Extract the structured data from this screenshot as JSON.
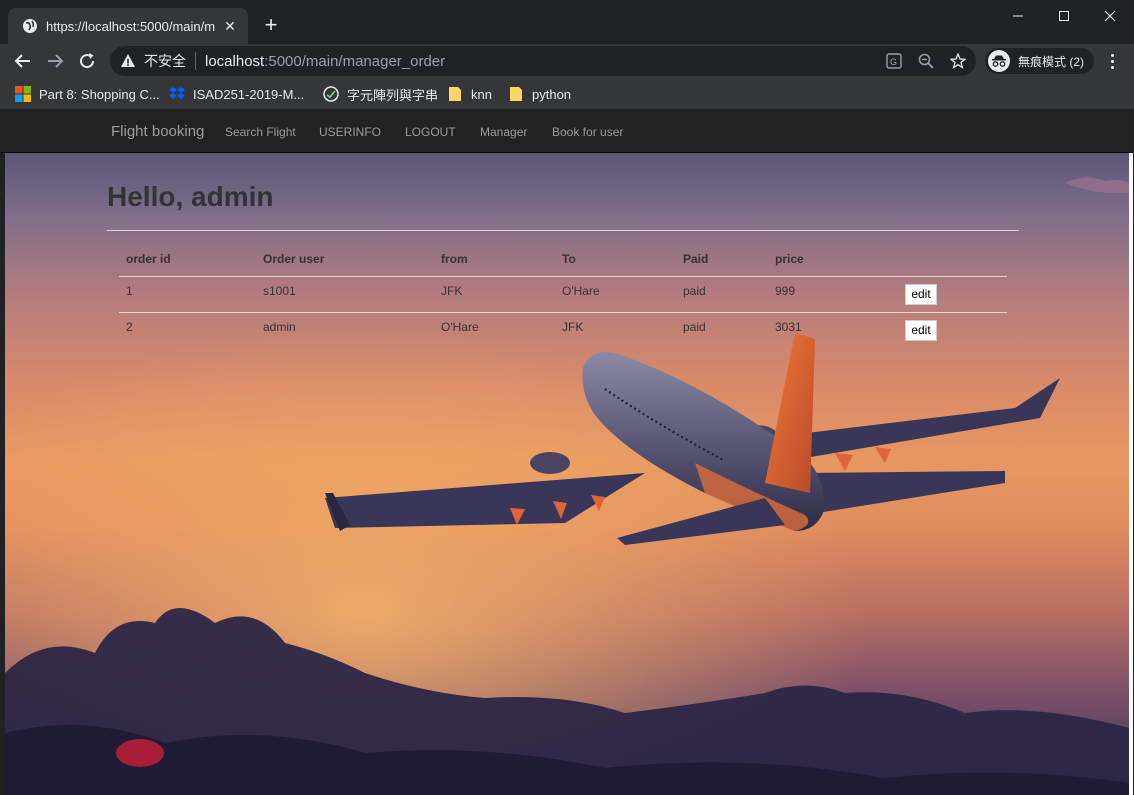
{
  "browser": {
    "tab_title": "https://localhost:5000/main/m",
    "address": {
      "security_label": "不安全",
      "host": "localhost",
      "path": ":5000/main/manager_order"
    },
    "incognito_label": "無痕模式 (2)",
    "bookmarks": [
      {
        "label": "Part 8: Shopping C...",
        "icon": "microsoft-icon"
      },
      {
        "label": "ISAD251-2019-M...",
        "icon": "dropbox-icon"
      },
      {
        "label": "字元陣列與字串",
        "icon": "site-icon"
      },
      {
        "label": "knn",
        "icon": "folder-icon"
      },
      {
        "label": "python",
        "icon": "folder-icon"
      }
    ]
  },
  "site": {
    "brand": "Flight booking",
    "nav": [
      "Search Flight",
      "USERINFO",
      "LOGOUT",
      "Manager",
      "Book for user"
    ]
  },
  "main": {
    "greeting": "Hello, admin",
    "table": {
      "headers": [
        "order id",
        "Order user",
        "from",
        "To",
        "Paid",
        "price",
        ""
      ],
      "rows": [
        {
          "order_id": "1",
          "user": "s1001",
          "from": "JFK",
          "to": "O'Hare",
          "paid": "paid",
          "price": "999",
          "action": "edit"
        },
        {
          "order_id": "2",
          "user": "admin",
          "from": "O'Hare",
          "to": "JFK",
          "paid": "paid",
          "price": "3031",
          "action": "edit"
        }
      ]
    }
  },
  "colors": {
    "chrome_dark": "#202124",
    "chrome_mid": "#35363a",
    "navbar_bg": "#222222",
    "navbar_text": "#9d9d9d"
  }
}
